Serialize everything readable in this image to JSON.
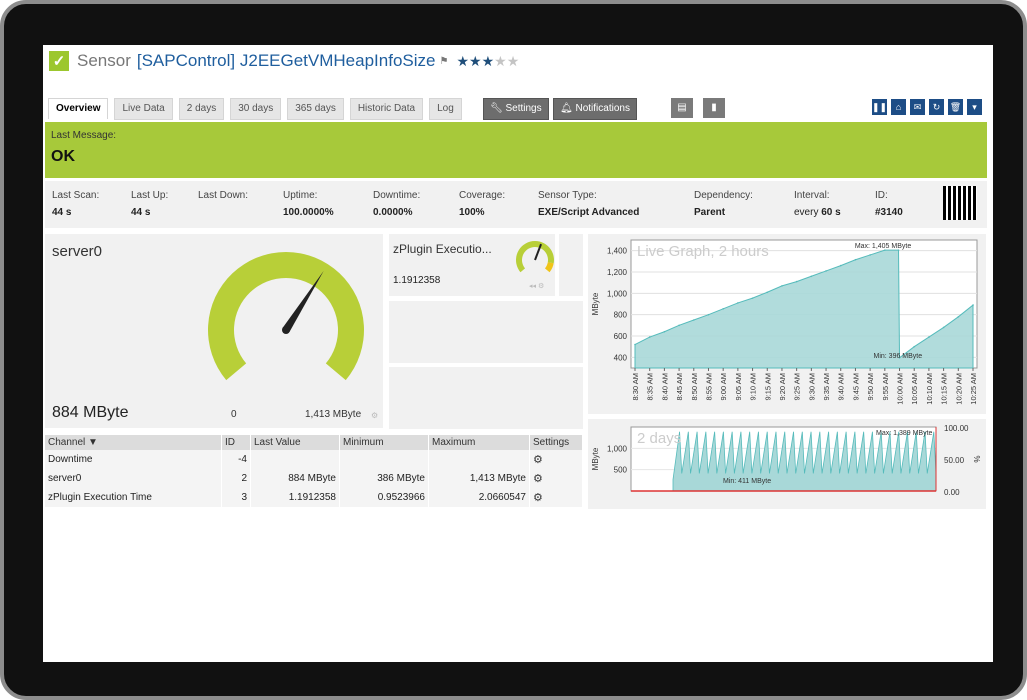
{
  "header": {
    "sensor_label": "Sensor",
    "sensor_name": "[SAPControl] J2EEGetVMHeapInfoSize",
    "flag": "⚑",
    "stars": {
      "filled": 3,
      "total": 5
    }
  },
  "tabs": [
    "Overview",
    "Live Data",
    "2 days",
    "30 days",
    "365 days",
    "Historic Data",
    "Log"
  ],
  "toolbar": {
    "settings": "Settings",
    "notifications": "Notifications"
  },
  "status": {
    "label": "Last Message:",
    "value": "OK"
  },
  "info": [
    {
      "label": "Last Scan:",
      "value": "44 s"
    },
    {
      "label": "Last Up:",
      "value": "44 s"
    },
    {
      "label": "Last Down:",
      "value": ""
    },
    {
      "label": "Uptime:",
      "value": "100.0000%"
    },
    {
      "label": "Downtime:",
      "value": "0.0000%"
    },
    {
      "label": "Coverage:",
      "value": "100%"
    },
    {
      "label": "Sensor Type:",
      "value": "EXE/Script Advanced"
    },
    {
      "label": "Dependency:",
      "value": "Parent"
    },
    {
      "label": "Interval:",
      "value_prefix": "every ",
      "value": "60 s"
    },
    {
      "label": "ID:",
      "value": "#3140"
    }
  ],
  "gauge_main": {
    "title": "server0",
    "value": "884 MByte",
    "min": "0",
    "max": "1,413 MByte",
    "fraction": 0.625
  },
  "gauge_small": {
    "title": "zPlugin Executio...",
    "value": "1.1912358",
    "fraction": 0.58
  },
  "table": {
    "headers": [
      "Channel",
      "ID",
      "Last Value",
      "Minimum",
      "Maximum",
      "Settings"
    ],
    "rows": [
      {
        "channel": "Downtime",
        "id": "-4",
        "last": "",
        "min": "",
        "max": ""
      },
      {
        "channel": "server0",
        "id": "2",
        "last": "884 MByte",
        "min": "386 MByte",
        "max": "1,413 MByte"
      },
      {
        "channel": "zPlugin Execution Time",
        "id": "3",
        "last": "1.1912358",
        "min": "0.9523966",
        "max": "2.0660547"
      }
    ]
  },
  "chart_data": [
    {
      "type": "area",
      "title": "Live Graph, 2 hours",
      "ylabel": "MByte",
      "ylim": [
        300,
        1500
      ],
      "yticks": [
        "1,400",
        "1,200",
        "1,000",
        "800",
        "600",
        "400"
      ],
      "x": [
        "8:30 AM",
        "8:35 AM",
        "8:40 AM",
        "8:45 AM",
        "8:50 AM",
        "8:55 AM",
        "9:00 AM",
        "9:05 AM",
        "9:10 AM",
        "9:15 AM",
        "9:20 AM",
        "9:25 AM",
        "9:30 AM",
        "9:35 AM",
        "9:40 AM",
        "9:45 AM",
        "9:50 AM",
        "9:55 AM",
        "10:00 AM",
        "10:05 AM",
        "10:10 AM",
        "10:15 AM",
        "10:20 AM",
        "10:25 AM"
      ],
      "values": [
        520,
        590,
        640,
        700,
        750,
        800,
        855,
        910,
        955,
        1010,
        1070,
        1110,
        1160,
        1210,
        1260,
        1315,
        1360,
        1405,
        396,
        500,
        590,
        680,
        780,
        890
      ],
      "annotations": [
        "Max: 1,405 MByte",
        "Min: 396 MByte"
      ],
      "color": "#a8d8d8"
    },
    {
      "type": "area",
      "title": "2 days",
      "ylabel": "MByte",
      "y2label": "%",
      "ylim": [
        0,
        1500
      ],
      "yticks": [
        "1,000",
        "500"
      ],
      "y2ticks": [
        "100.00",
        "50.00",
        "0.00"
      ],
      "annotations": [
        "Max: 1,389 MByte",
        "Min: 411 MByte"
      ],
      "color": "#a8d8d8"
    }
  ]
}
